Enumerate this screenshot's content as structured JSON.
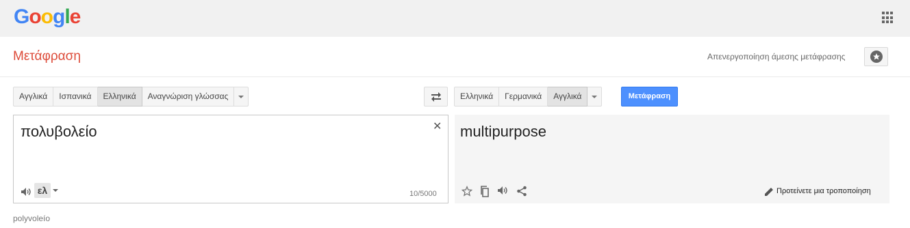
{
  "header": {
    "logo_text": "Google",
    "apps_icon": "apps-grid-icon"
  },
  "page": {
    "title": "Μετάφραση",
    "disable_instant_link": "Απενεργοποίηση άμεσης μετάφρασης",
    "star_icon": "star-icon"
  },
  "source_languages": {
    "items": [
      "Αγγλικά",
      "Ισπανικά",
      "Ελληνικά",
      "Αναγνώριση γλώσσας"
    ],
    "selected": "Ελληνικά"
  },
  "target_languages": {
    "items": [
      "Ελληνικά",
      "Γερμανικά",
      "Αγγλικά"
    ],
    "selected": "Αγγλικά"
  },
  "swap_icon": "swap-languages-icon",
  "translate_button": "Μετάφραση",
  "source": {
    "text": "πολυβολείο",
    "char_count": "10/5000",
    "input_tool_label": "ελ",
    "transliteration": "polyvoleío"
  },
  "result": {
    "text": "multipurpose",
    "suggest_edit": "Προτείνετε μια τροποποίηση"
  },
  "colors": {
    "accent_red": "#dd4b39",
    "button_blue": "#4d90fe"
  }
}
